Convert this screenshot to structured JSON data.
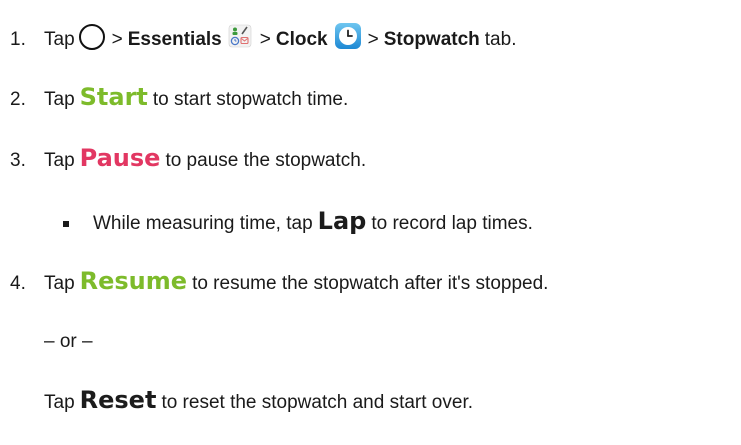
{
  "steps": [
    {
      "number": "1.",
      "tap": "Tap",
      "sep1": ">",
      "essentials": "Essentials",
      "sep2": ">",
      "clock": "Clock",
      "sep3": ">",
      "stopwatch": "Stopwatch",
      "tab": "tab."
    },
    {
      "number": "2.",
      "tap": "Tap",
      "key": "Start",
      "rest": "to start stopwatch time."
    },
    {
      "number": "3.",
      "tap": "Tap",
      "key": "Pause",
      "rest": "to pause the stopwatch."
    },
    {
      "prefix": "While measuring time, tap",
      "key": "Lap",
      "rest": "to record lap times."
    },
    {
      "number": "4.",
      "tap": "Tap",
      "key": "Resume",
      "rest": "to resume the stopwatch after it's stopped."
    },
    {
      "text": "– or –"
    },
    {
      "tap": "Tap",
      "key": "Reset",
      "rest": "to reset the stopwatch and start over."
    }
  ],
  "colors": {
    "start": "#7dbb2b",
    "pause": "#e23762",
    "lap": "#1c1c1c",
    "resume": "#7dbb2b",
    "reset": "#1c1c1c"
  },
  "icons": {
    "home": "home-circle-icon",
    "essentials": "essentials-folder-icon",
    "clock": "clock-app-icon"
  }
}
